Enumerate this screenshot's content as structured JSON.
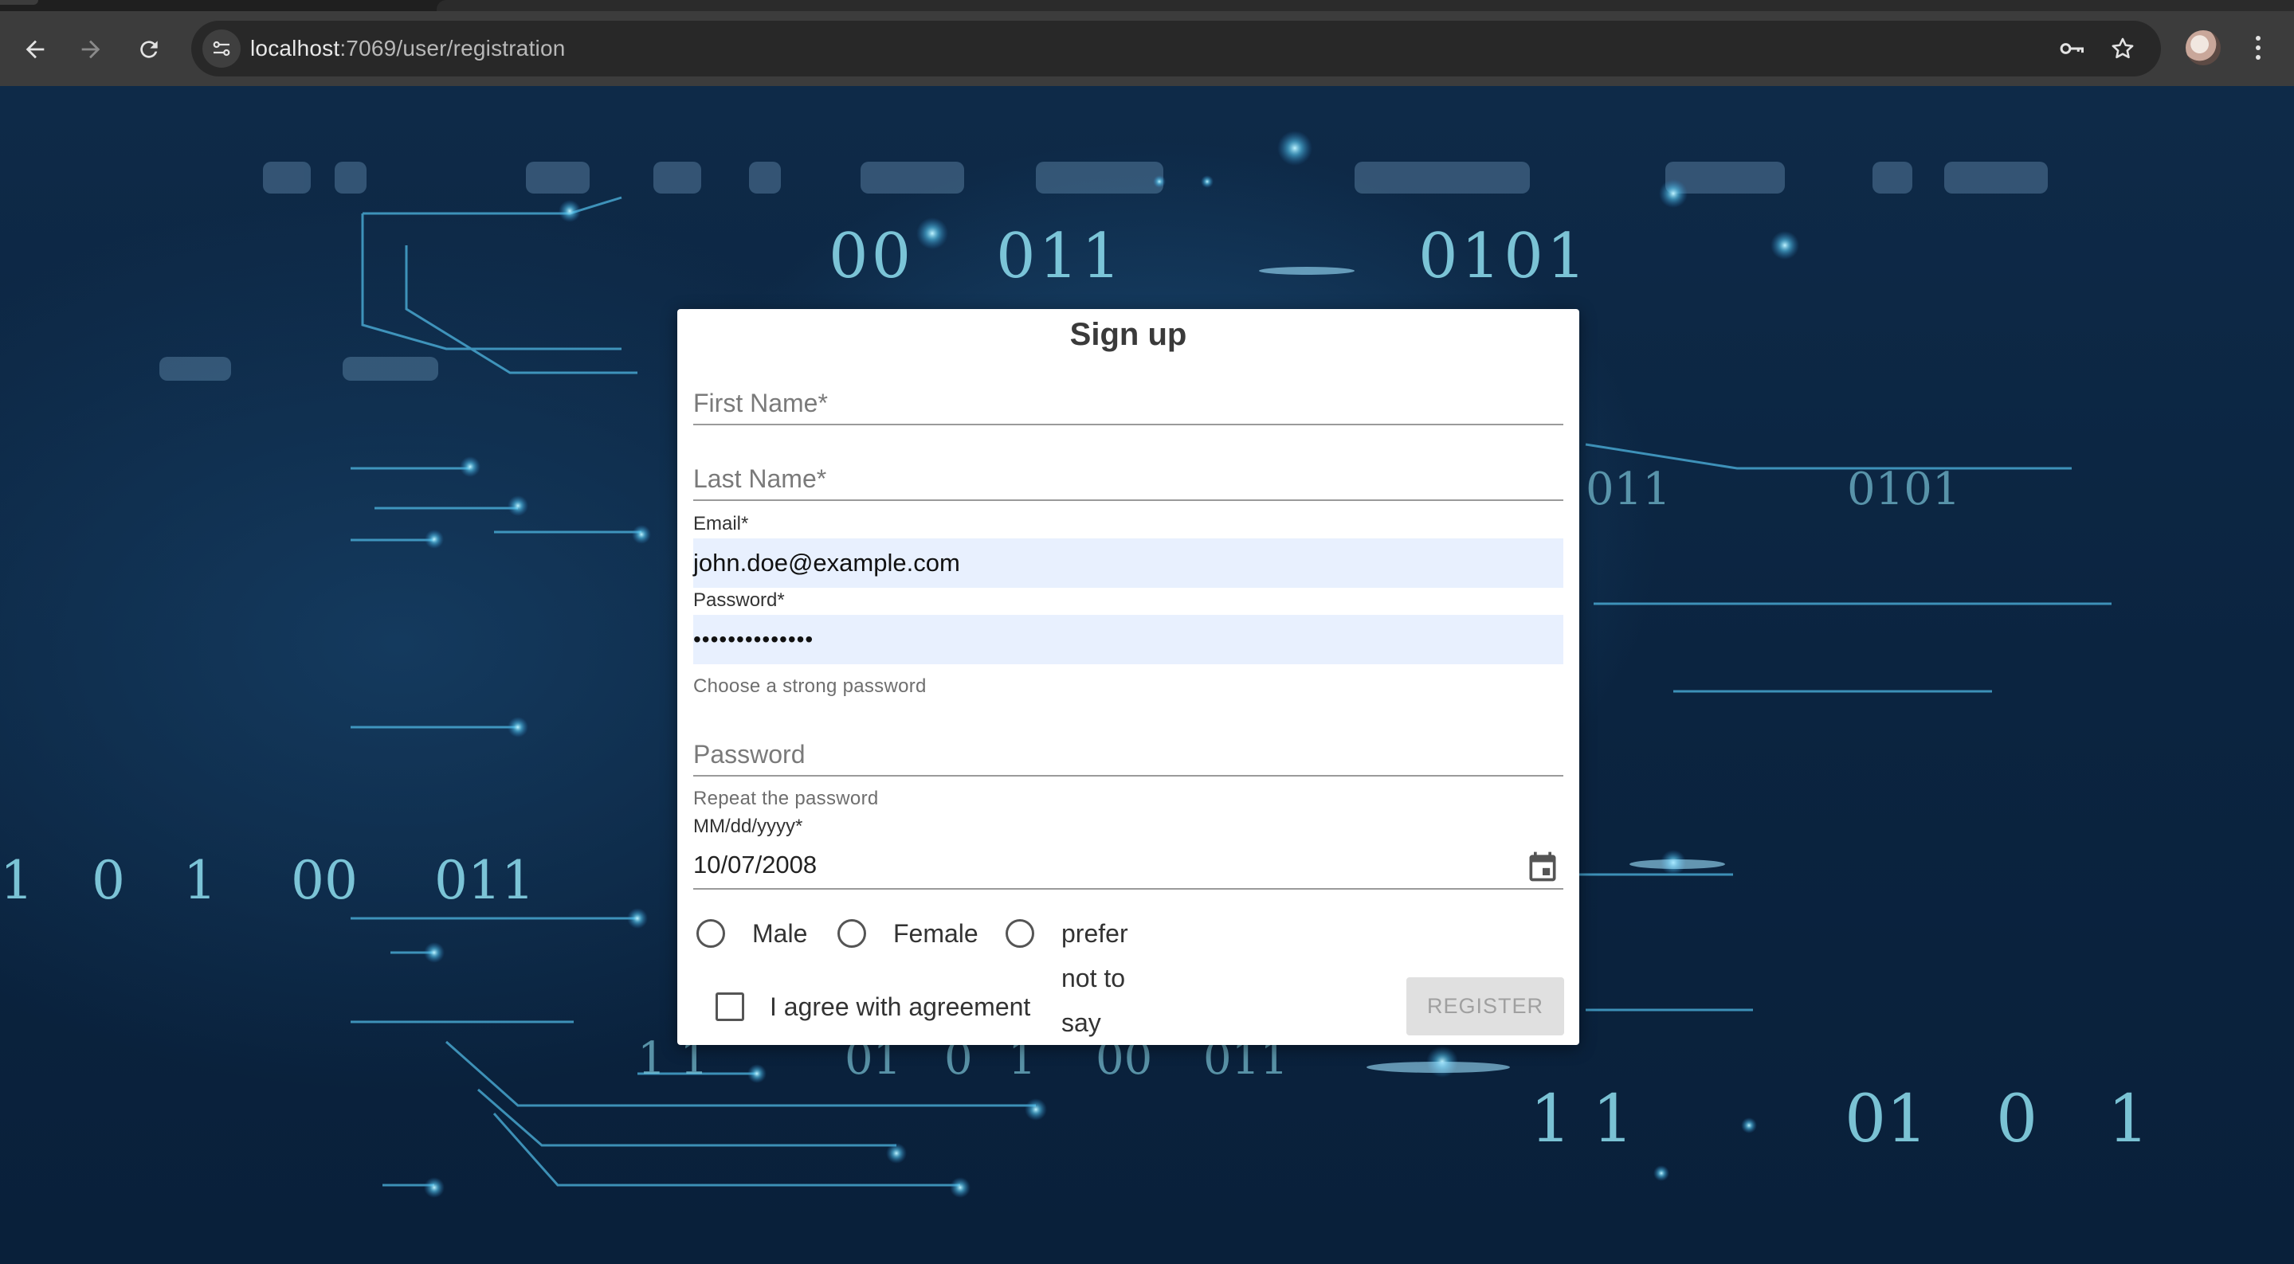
{
  "browser": {
    "url_host": "localhost",
    "url_path": ":7069/user/registration",
    "icons": [
      "back-icon",
      "forward-icon",
      "reload-icon",
      "site-info-icon",
      "password-key-icon",
      "bookmark-star-icon",
      "profile-avatar",
      "more-menu-icon"
    ]
  },
  "background": {
    "binary_texts": [
      "00",
      "011",
      "0101",
      "011",
      "0101",
      "1",
      "0",
      "1",
      "00",
      "011",
      "1 1",
      "01",
      "0",
      "1",
      "00",
      "011",
      "1 1",
      "01",
      "0",
      "1"
    ]
  },
  "form": {
    "title": "Sign up",
    "first_name": {
      "placeholder": "First Name*",
      "value": ""
    },
    "last_name": {
      "placeholder": "Last Name*",
      "value": ""
    },
    "email": {
      "label": "Email*",
      "value": "john.doe@example.com"
    },
    "password": {
      "label": "Password*",
      "masked_value": "••••••••••••••",
      "hint": "Choose a strong password"
    },
    "repeat_password": {
      "placeholder": "Password",
      "hint": "Repeat the password"
    },
    "birthdate": {
      "label": "MM/dd/yyyy*",
      "value": "10/07/2008"
    },
    "gender_options": [
      "Male",
      "Female",
      "prefer not to say"
    ],
    "agreement_label": "I agree with agreement",
    "register_label": "REGISTER"
  },
  "colors": {
    "autofill_bg": "#e8f0fe",
    "chrome_toolbar": "#3c3c3c",
    "register_disabled_bg": "#e0e0e0"
  }
}
